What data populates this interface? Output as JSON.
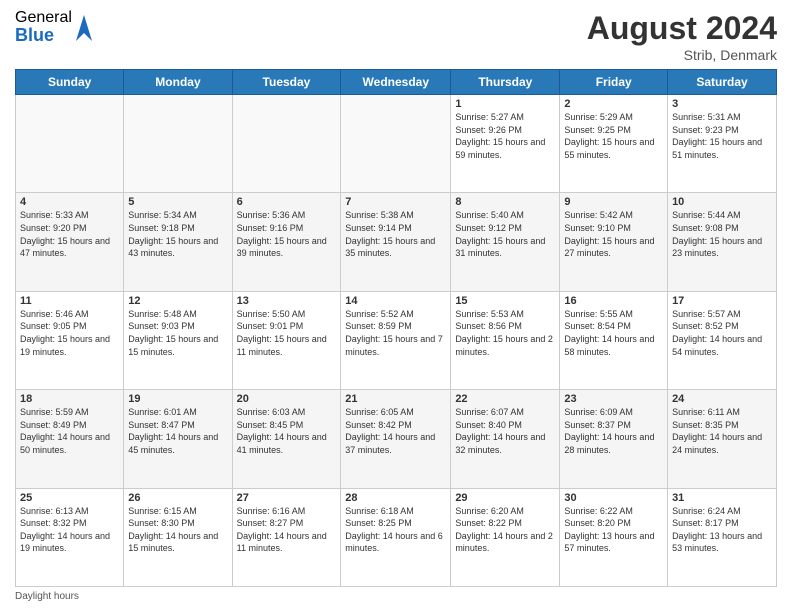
{
  "header": {
    "logo_general": "General",
    "logo_blue": "Blue",
    "month_year": "August 2024",
    "location": "Strib, Denmark"
  },
  "days_of_week": [
    "Sunday",
    "Monday",
    "Tuesday",
    "Wednesday",
    "Thursday",
    "Friday",
    "Saturday"
  ],
  "weeks": [
    [
      {
        "day": "",
        "info": ""
      },
      {
        "day": "",
        "info": ""
      },
      {
        "day": "",
        "info": ""
      },
      {
        "day": "",
        "info": ""
      },
      {
        "day": "1",
        "info": "Sunrise: 5:27 AM\nSunset: 9:26 PM\nDaylight: 15 hours and 59 minutes."
      },
      {
        "day": "2",
        "info": "Sunrise: 5:29 AM\nSunset: 9:25 PM\nDaylight: 15 hours and 55 minutes."
      },
      {
        "day": "3",
        "info": "Sunrise: 5:31 AM\nSunset: 9:23 PM\nDaylight: 15 hours and 51 minutes."
      }
    ],
    [
      {
        "day": "4",
        "info": "Sunrise: 5:33 AM\nSunset: 9:20 PM\nDaylight: 15 hours and 47 minutes."
      },
      {
        "day": "5",
        "info": "Sunrise: 5:34 AM\nSunset: 9:18 PM\nDaylight: 15 hours and 43 minutes."
      },
      {
        "day": "6",
        "info": "Sunrise: 5:36 AM\nSunset: 9:16 PM\nDaylight: 15 hours and 39 minutes."
      },
      {
        "day": "7",
        "info": "Sunrise: 5:38 AM\nSunset: 9:14 PM\nDaylight: 15 hours and 35 minutes."
      },
      {
        "day": "8",
        "info": "Sunrise: 5:40 AM\nSunset: 9:12 PM\nDaylight: 15 hours and 31 minutes."
      },
      {
        "day": "9",
        "info": "Sunrise: 5:42 AM\nSunset: 9:10 PM\nDaylight: 15 hours and 27 minutes."
      },
      {
        "day": "10",
        "info": "Sunrise: 5:44 AM\nSunset: 9:08 PM\nDaylight: 15 hours and 23 minutes."
      }
    ],
    [
      {
        "day": "11",
        "info": "Sunrise: 5:46 AM\nSunset: 9:05 PM\nDaylight: 15 hours and 19 minutes."
      },
      {
        "day": "12",
        "info": "Sunrise: 5:48 AM\nSunset: 9:03 PM\nDaylight: 15 hours and 15 minutes."
      },
      {
        "day": "13",
        "info": "Sunrise: 5:50 AM\nSunset: 9:01 PM\nDaylight: 15 hours and 11 minutes."
      },
      {
        "day": "14",
        "info": "Sunrise: 5:52 AM\nSunset: 8:59 PM\nDaylight: 15 hours and 7 minutes."
      },
      {
        "day": "15",
        "info": "Sunrise: 5:53 AM\nSunset: 8:56 PM\nDaylight: 15 hours and 2 minutes."
      },
      {
        "day": "16",
        "info": "Sunrise: 5:55 AM\nSunset: 8:54 PM\nDaylight: 14 hours and 58 minutes."
      },
      {
        "day": "17",
        "info": "Sunrise: 5:57 AM\nSunset: 8:52 PM\nDaylight: 14 hours and 54 minutes."
      }
    ],
    [
      {
        "day": "18",
        "info": "Sunrise: 5:59 AM\nSunset: 8:49 PM\nDaylight: 14 hours and 50 minutes."
      },
      {
        "day": "19",
        "info": "Sunrise: 6:01 AM\nSunset: 8:47 PM\nDaylight: 14 hours and 45 minutes."
      },
      {
        "day": "20",
        "info": "Sunrise: 6:03 AM\nSunset: 8:45 PM\nDaylight: 14 hours and 41 minutes."
      },
      {
        "day": "21",
        "info": "Sunrise: 6:05 AM\nSunset: 8:42 PM\nDaylight: 14 hours and 37 minutes."
      },
      {
        "day": "22",
        "info": "Sunrise: 6:07 AM\nSunset: 8:40 PM\nDaylight: 14 hours and 32 minutes."
      },
      {
        "day": "23",
        "info": "Sunrise: 6:09 AM\nSunset: 8:37 PM\nDaylight: 14 hours and 28 minutes."
      },
      {
        "day": "24",
        "info": "Sunrise: 6:11 AM\nSunset: 8:35 PM\nDaylight: 14 hours and 24 minutes."
      }
    ],
    [
      {
        "day": "25",
        "info": "Sunrise: 6:13 AM\nSunset: 8:32 PM\nDaylight: 14 hours and 19 minutes."
      },
      {
        "day": "26",
        "info": "Sunrise: 6:15 AM\nSunset: 8:30 PM\nDaylight: 14 hours and 15 minutes."
      },
      {
        "day": "27",
        "info": "Sunrise: 6:16 AM\nSunset: 8:27 PM\nDaylight: 14 hours and 11 minutes."
      },
      {
        "day": "28",
        "info": "Sunrise: 6:18 AM\nSunset: 8:25 PM\nDaylight: 14 hours and 6 minutes."
      },
      {
        "day": "29",
        "info": "Sunrise: 6:20 AM\nSunset: 8:22 PM\nDaylight: 14 hours and 2 minutes."
      },
      {
        "day": "30",
        "info": "Sunrise: 6:22 AM\nSunset: 8:20 PM\nDaylight: 13 hours and 57 minutes."
      },
      {
        "day": "31",
        "info": "Sunrise: 6:24 AM\nSunset: 8:17 PM\nDaylight: 13 hours and 53 minutes."
      }
    ]
  ],
  "footer": {
    "daylight_hours_label": "Daylight hours"
  }
}
